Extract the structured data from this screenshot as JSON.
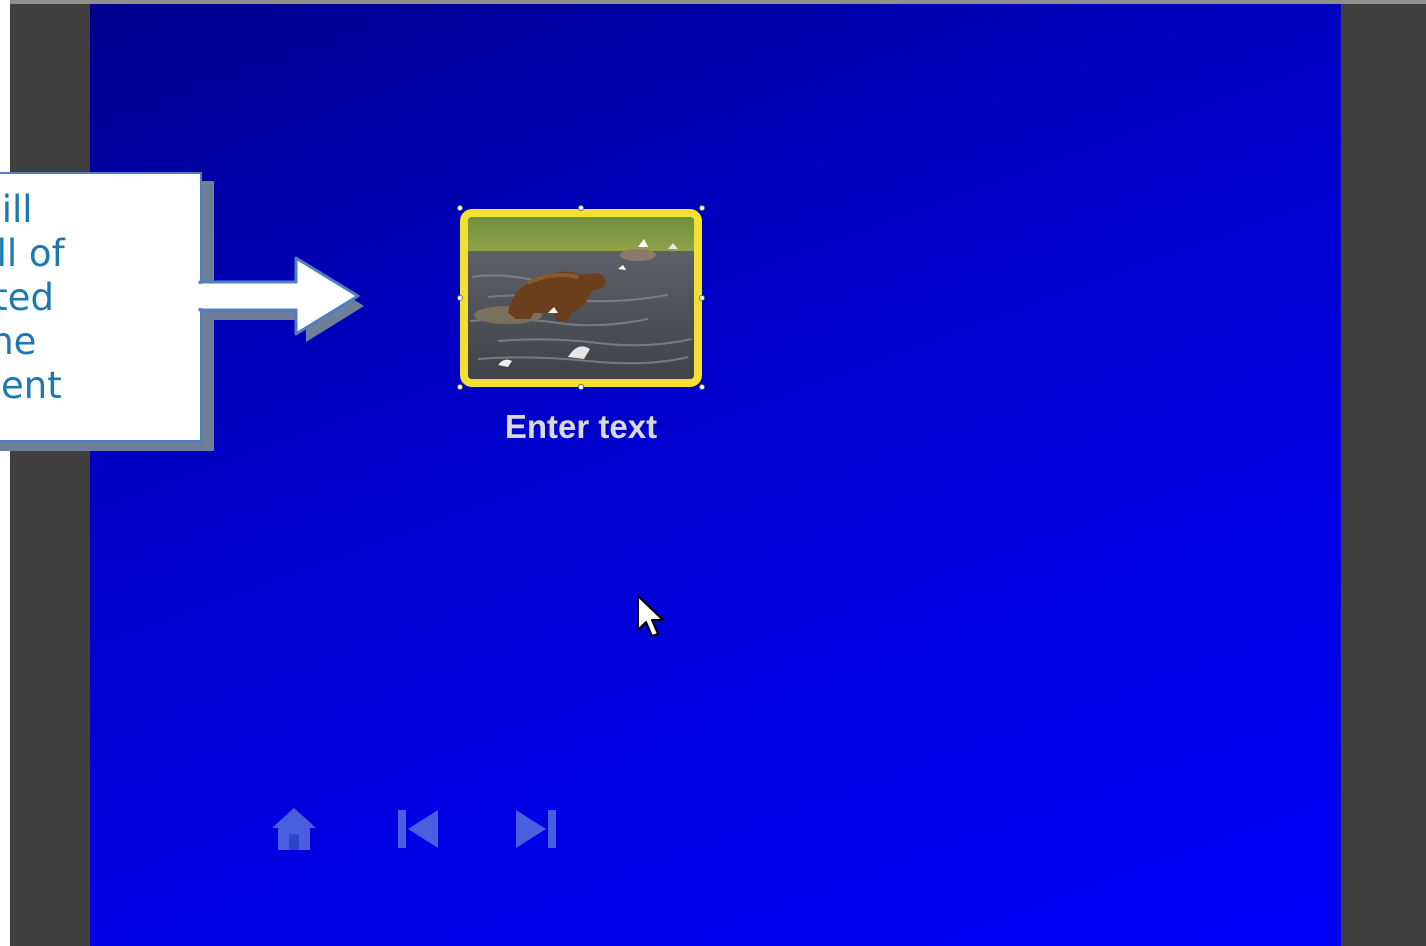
{
  "callout": {
    "lines": [
      "will",
      "e all of",
      "ected",
      "one",
      "ement"
    ]
  },
  "thumbnail": {
    "caption": "Enter text",
    "image_icon": "bear-in-river-photo",
    "frame_color": "#f3e131"
  },
  "navigation": {
    "home_icon": "home-icon",
    "previous_icon": "skip-back-icon",
    "next_icon": "skip-forward-icon",
    "icon_color": "#4a5fe0"
  },
  "colors": {
    "stage_dark": "#00008c",
    "stage_light": "#0000f8",
    "side_bars": "#3f3f3f",
    "callout_text": "#1b78b0",
    "callout_border": "#4f7fc0"
  }
}
